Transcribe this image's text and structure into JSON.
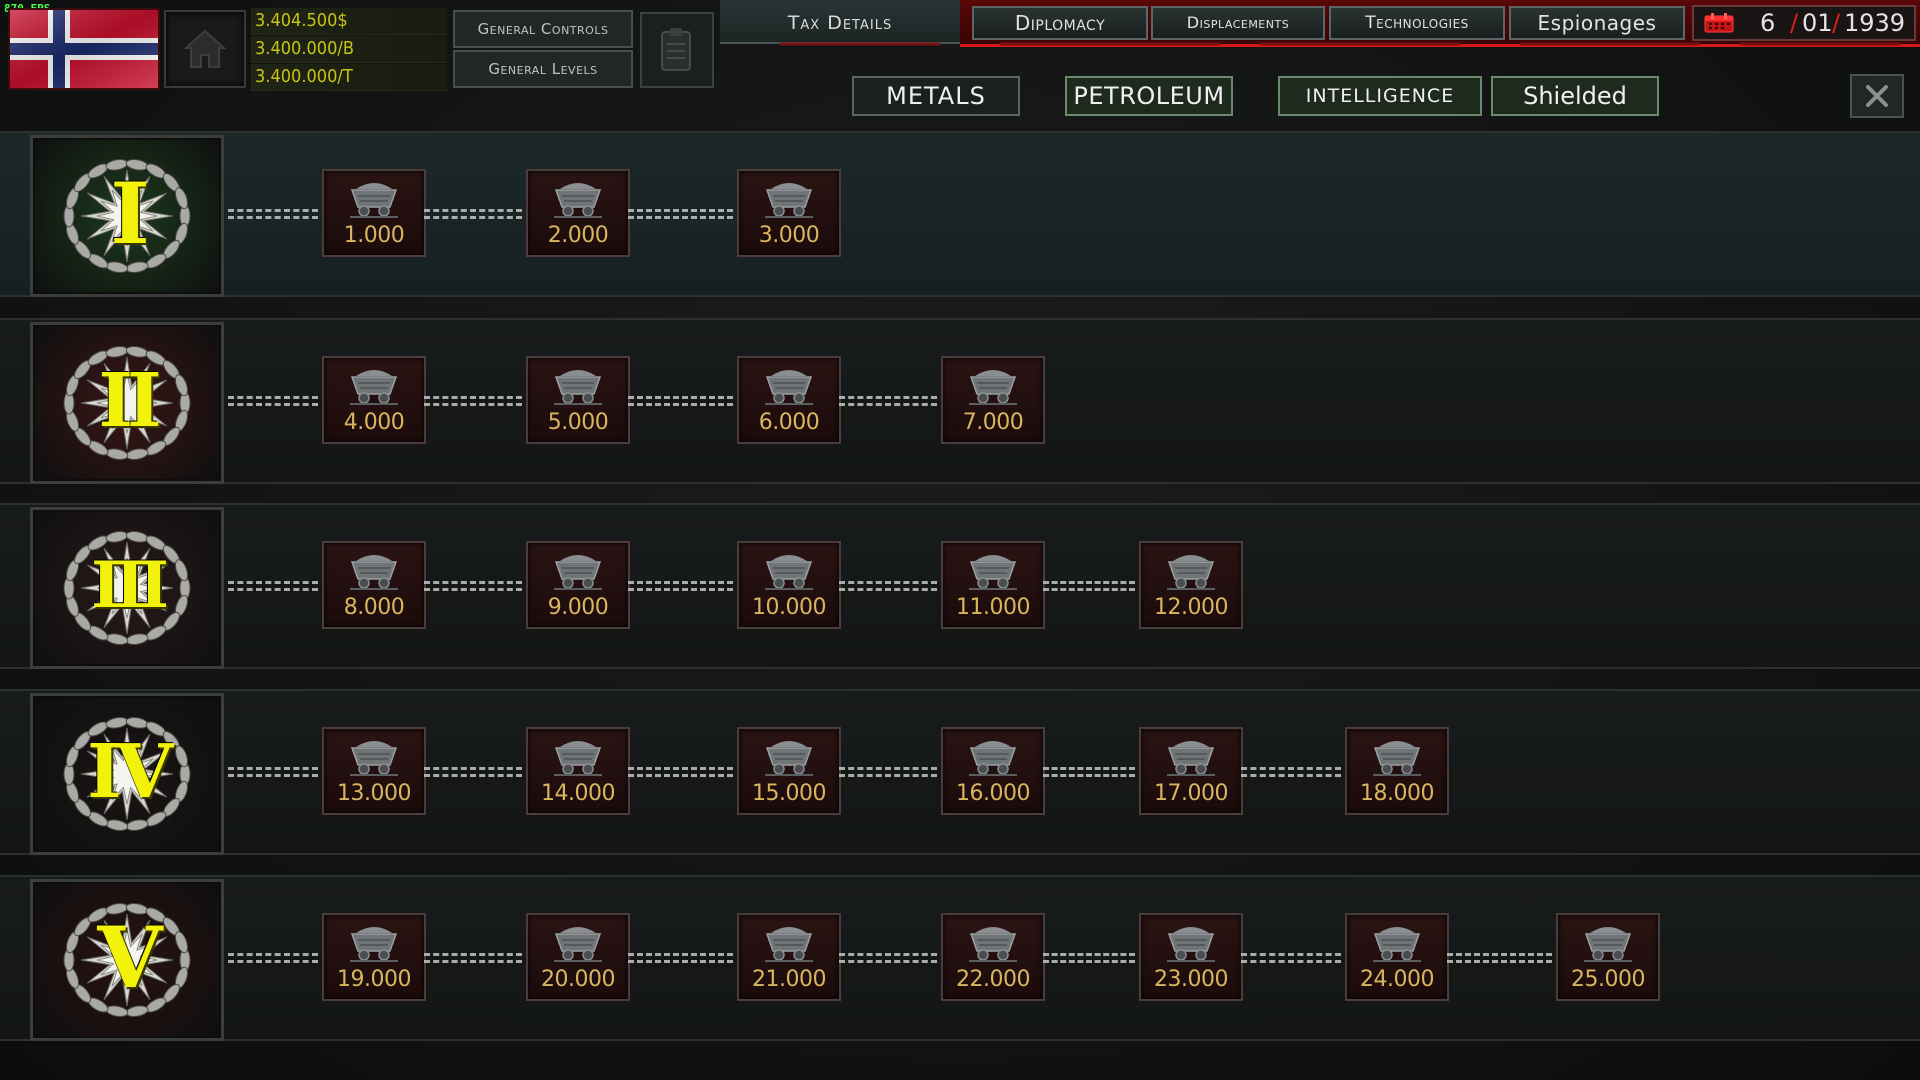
{
  "fps": "870 FPS",
  "resources": {
    "money": "3.404.500$",
    "per_b": "3.400.000/B",
    "per_t": "3.400.000/T"
  },
  "buttons": {
    "general_controls": "General Controls",
    "general_levels": "General Levels",
    "tax_details": "Tax Details"
  },
  "nav_tabs": [
    "Diplomacy",
    "Displacements",
    "Technologies",
    "Espionages"
  ],
  "date": {
    "day": "6",
    "month": "01",
    "year": "1939"
  },
  "filters": [
    "METALS",
    "PETROLEUM",
    "INTELLIGENCE",
    "Shielded"
  ],
  "tiers": [
    {
      "numeral": "I",
      "amounts": [
        "1.000",
        "2.000",
        "3.000"
      ]
    },
    {
      "numeral": "II",
      "amounts": [
        "4.000",
        "5.000",
        "6.000",
        "7.000"
      ]
    },
    {
      "numeral": "III",
      "amounts": [
        "8.000",
        "9.000",
        "10.000",
        "11.000",
        "12.000"
      ]
    },
    {
      "numeral": "IV",
      "amounts": [
        "13.000",
        "14.000",
        "15.000",
        "16.000",
        "17.000",
        "18.000"
      ]
    },
    {
      "numeral": "V",
      "amounts": [
        "19.000",
        "20.000",
        "21.000",
        "22.000",
        "23.000",
        "24.000",
        "25.000"
      ]
    }
  ],
  "colors": {
    "accent_red": "#d61818",
    "amount_gold": "#d8b55e",
    "numeral_yellow": "#f2f20a",
    "resource_yellow": "#c8c414"
  }
}
